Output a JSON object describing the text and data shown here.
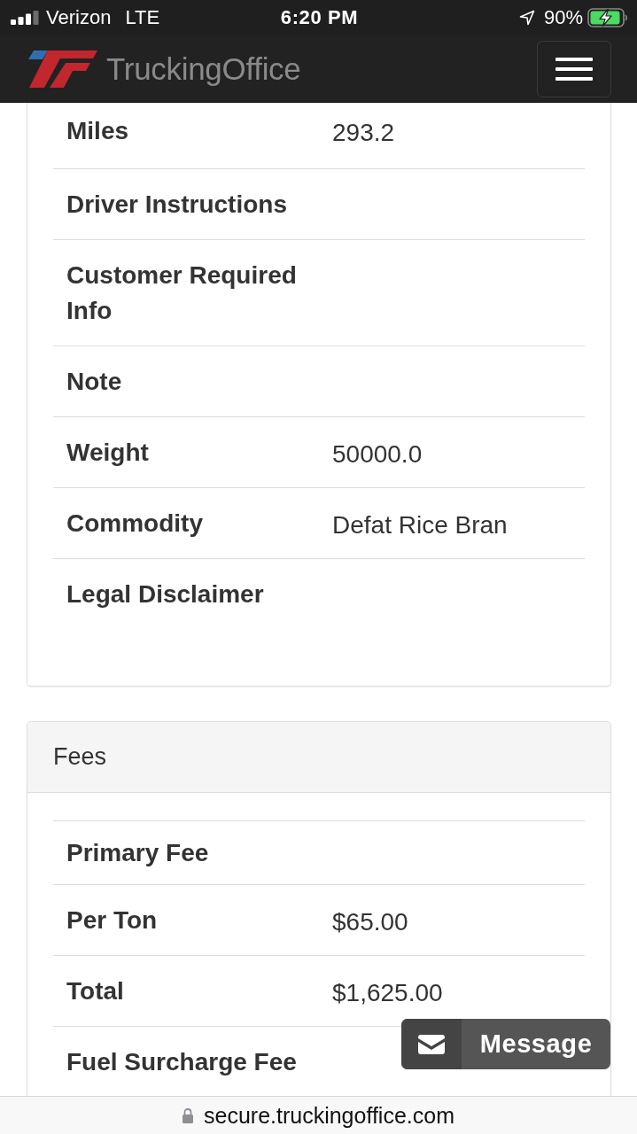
{
  "status_bar": {
    "carrier": "Verizon",
    "network": "LTE",
    "time": "6:20 PM",
    "battery": "90%",
    "charging": true
  },
  "navbar": {
    "brand": "TruckingOffice"
  },
  "details": {
    "rows": [
      {
        "label": "Miles",
        "value": "293.2"
      },
      {
        "label": "Driver Instructions"
      },
      {
        "label": "Customer Required Info"
      },
      {
        "label": "Note"
      },
      {
        "label": "Weight",
        "value": "50000.0"
      },
      {
        "label": "Commodity",
        "value": "Defat Rice Bran"
      },
      {
        "label": "Legal Disclaimer"
      }
    ]
  },
  "fees": {
    "title": "Fees",
    "rows": [
      {
        "label": "Primary Fee"
      },
      {
        "label": "Per Ton",
        "value": "$65.00"
      },
      {
        "label": "Total",
        "value": "$1,625.00"
      },
      {
        "label": "Fuel Surcharge Fee"
      }
    ]
  },
  "message_button": {
    "label": "Message"
  },
  "address_bar": {
    "url": "secure.truckingoffice.com"
  }
}
